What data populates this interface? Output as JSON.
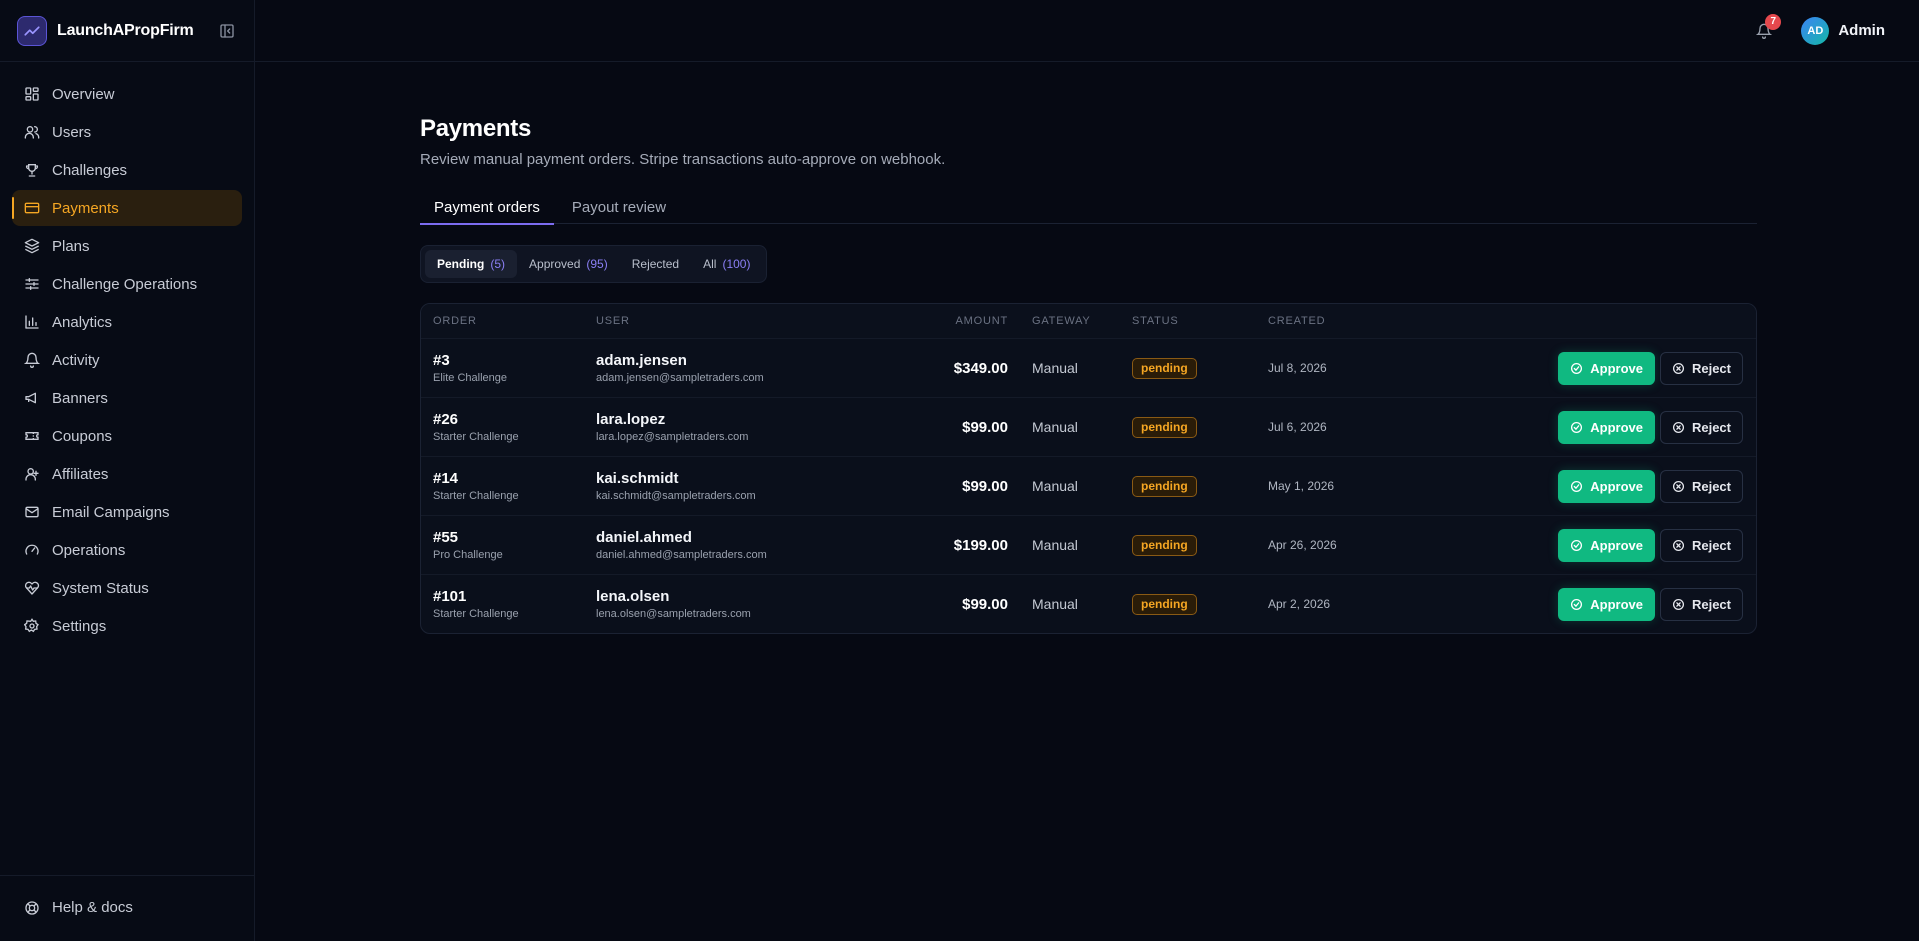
{
  "brand": {
    "name": "LaunchAPropFirm"
  },
  "sidebar": {
    "items": [
      {
        "label": "Overview",
        "icon": "grid-icon"
      },
      {
        "label": "Users",
        "icon": "users-icon"
      },
      {
        "label": "Challenges",
        "icon": "trophy-icon"
      },
      {
        "label": "Payments",
        "icon": "credit-card-icon",
        "active": true
      },
      {
        "label": "Plans",
        "icon": "layers-icon"
      },
      {
        "label": "Challenge Operations",
        "icon": "sliders-icon"
      },
      {
        "label": "Analytics",
        "icon": "bar-chart-icon"
      },
      {
        "label": "Activity",
        "icon": "bell-icon"
      },
      {
        "label": "Banners",
        "icon": "megaphone-icon"
      },
      {
        "label": "Coupons",
        "icon": "ticket-icon"
      },
      {
        "label": "Affiliates",
        "icon": "user-icon"
      },
      {
        "label": "Email Campaigns",
        "icon": "mail-icon"
      },
      {
        "label": "Operations",
        "icon": "gauge-icon"
      },
      {
        "label": "System Status",
        "icon": "heart-pulse-icon"
      },
      {
        "label": "Settings",
        "icon": "gear-icon"
      }
    ],
    "help_label": "Help & docs"
  },
  "topbar": {
    "notifications_count": "7",
    "avatar_initials": "AD",
    "user_name": "Admin"
  },
  "page": {
    "title": "Payments",
    "subtitle": "Review manual payment orders. Stripe transactions auto-approve on webhook."
  },
  "tabs": [
    {
      "label": "Payment orders",
      "active": true
    },
    {
      "label": "Payout review",
      "active": false
    }
  ],
  "filters": [
    {
      "label": "Pending",
      "count": "(5)",
      "active": true
    },
    {
      "label": "Approved",
      "count": "(95)",
      "active": false
    },
    {
      "label": "Rejected",
      "count": "",
      "active": false
    },
    {
      "label": "All",
      "count": "(100)",
      "active": false
    }
  ],
  "table": {
    "columns": {
      "order": "ORDER",
      "user": "USER",
      "amount": "AMOUNT",
      "gateway": "GATEWAY",
      "status": "STATUS",
      "created": "CREATED"
    },
    "approve_label": "Approve",
    "reject_label": "Reject",
    "rows": [
      {
        "order": "#3",
        "plan": "Elite Challenge",
        "user": "adam.jensen",
        "email": "adam.jensen@sampletraders.com",
        "amount": "$349.00",
        "gateway": "Manual",
        "status": "pending",
        "created": "Jul 8, 2026"
      },
      {
        "order": "#26",
        "plan": "Starter Challenge",
        "user": "lara.lopez",
        "email": "lara.lopez@sampletraders.com",
        "amount": "$99.00",
        "gateway": "Manual",
        "status": "pending",
        "created": "Jul 6, 2026"
      },
      {
        "order": "#14",
        "plan": "Starter Challenge",
        "user": "kai.schmidt",
        "email": "kai.schmidt@sampletraders.com",
        "amount": "$99.00",
        "gateway": "Manual",
        "status": "pending",
        "created": "May 1, 2026"
      },
      {
        "order": "#55",
        "plan": "Pro Challenge",
        "user": "daniel.ahmed",
        "email": "daniel.ahmed@sampletraders.com",
        "amount": "$199.00",
        "gateway": "Manual",
        "status": "pending",
        "created": "Apr 26, 2026"
      },
      {
        "order": "#101",
        "plan": "Starter Challenge",
        "user": "lena.olsen",
        "email": "lena.olsen@sampletraders.com",
        "amount": "$99.00",
        "gateway": "Manual",
        "status": "pending",
        "created": "Apr 2, 2026"
      }
    ]
  },
  "colors": {
    "accent": "#7c6cf0",
    "active_nav": "#f5a623",
    "approve": "#10b981",
    "pending": "#f5a623",
    "badge": "#e5484d"
  }
}
